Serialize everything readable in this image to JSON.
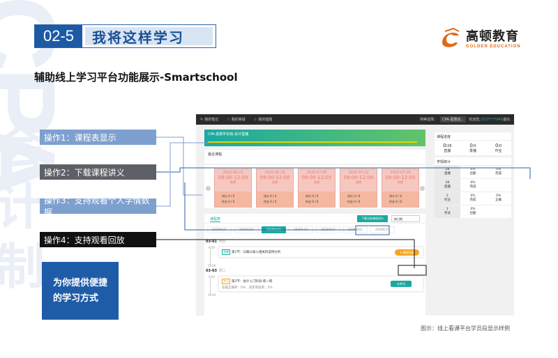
{
  "header": {
    "watermark": "CPA",
    "watermark_cn": "会计制",
    "section_number": "02-5",
    "section_title": "我将这样学习",
    "subtitle": "辅助线上学习平台功能展示-Smartschool"
  },
  "logo": {
    "name_cn": "高顿教育",
    "name_en": "GOLDEN EDUCATION",
    "brand_color": "#e06a17"
  },
  "operations": [
    {
      "label": "操作1：课程表显示"
    },
    {
      "label": "操作2：下载课程讲义"
    },
    {
      "label": "操作3：支持观看个人学情数据"
    },
    {
      "label": "操作4：支持观看回放"
    }
  ],
  "promo": {
    "line1": "为你提供便捷",
    "line2": "的学习方式"
  },
  "caption": "图示：线上看课平台学员段显示样例",
  "colors": {
    "primary_blue": "#1f5ca8",
    "teal": "#1aa9a0",
    "card_pink": "#f6c7c0",
    "replay_orange": "#f5a623"
  },
  "app": {
    "topbar": {
      "items": [
        {
          "icon": "note-icon",
          "label": "我的笔记"
        },
        {
          "icon": "star-icon",
          "label": "我的答疑"
        },
        {
          "icon": "star-icon",
          "label": "我的错题"
        }
      ],
      "course_label": "简等选择：",
      "course_value": "CPA-嘉惠班...",
      "welcome": "欢迎您,",
      "phone": "152****7940",
      "logout": "退出"
    },
    "course_header": "CPA-嘉惠学训班-会计直播",
    "recent_label": "最近课程",
    "cards": [
      {
        "date": "2020-06-21",
        "time": "09:00-12:00",
        "stat_label": "直播",
        "foot1": "讲义  0 / 0",
        "foot2": "作业  0 / 0"
      },
      {
        "date": "2020-06-28",
        "time": "09:00-12:00",
        "stat_label": "直播",
        "foot1": "讲义  0 / 0",
        "foot2": "作业  0 / 0"
      },
      {
        "date": "2020-07-05",
        "time": "09:05-12:05",
        "stat_label": "直播",
        "foot1": "讲义  0 / 0",
        "foot2": "作业  0 / 0"
      },
      {
        "date": "2020-07-12",
        "time": "09:00-12:00",
        "stat_label": "直播",
        "foot1": "讲义  0 / 0",
        "foot2": "作业  0 / 0"
      },
      {
        "date": "2020-07-19",
        "time": "09:00-12:00",
        "stat_label": "直播",
        "foot1": "讲义  0 / 0",
        "foot2": "作业  0 / 0"
      }
    ],
    "schedule": {
      "tab_label": "课程表",
      "download_button": "下载当前课程讲义",
      "day_select": "按日期",
      "months": [
        "2020年1月",
        "2020年2月",
        "2020年3月",
        "2020年4月",
        "2020年5月",
        "2020年6月",
        "2020年7月"
      ],
      "active_month_index": 2,
      "days": [
        {
          "date": "03-01",
          "weekday": "周日",
          "tag": "直播",
          "lesson": "第1节：与确认收入相关的案例分析",
          "action": "课程回放",
          "time_top": "9:00",
          "time_bottom": "12:00"
        },
        {
          "date": "03-03",
          "weekday": "周二",
          "tag": "考试",
          "lesson": "第2节：会计入门阶段-练一练",
          "meta1": "答题正确率：0%",
          "meta2": "试卷完成率：0%",
          "action": "去考试",
          "time_top": "9:00",
          "time_bottom": "12:00"
        }
      ]
    },
    "side": {
      "progress_title": "课程进度",
      "progress": [
        {
          "value": "0",
          "total": "/28",
          "label": "直播"
        },
        {
          "value": "0",
          "total": "/0",
          "label": "录播"
        },
        {
          "value": "0",
          "total": "/0",
          "label": "作业"
        }
      ],
      "stats_title": "学情统计",
      "stats": [
        {
          "count": "28",
          "label": "直播",
          "c1": "0%",
          "c1l": "出勤",
          "c2": "0%",
          "c2l": "完成"
        },
        {
          "count": "28",
          "label": "直播",
          "c1": "0%",
          "c1l": "完成"
        },
        {
          "count": "2",
          "label": "作业",
          "c1": "0%",
          "c1l": "完成",
          "c2": "0%",
          "c2l": "正确"
        },
        {
          "count": "1",
          "label": "考试",
          "c1": "0%",
          "c1l": "出勤"
        }
      ]
    }
  }
}
